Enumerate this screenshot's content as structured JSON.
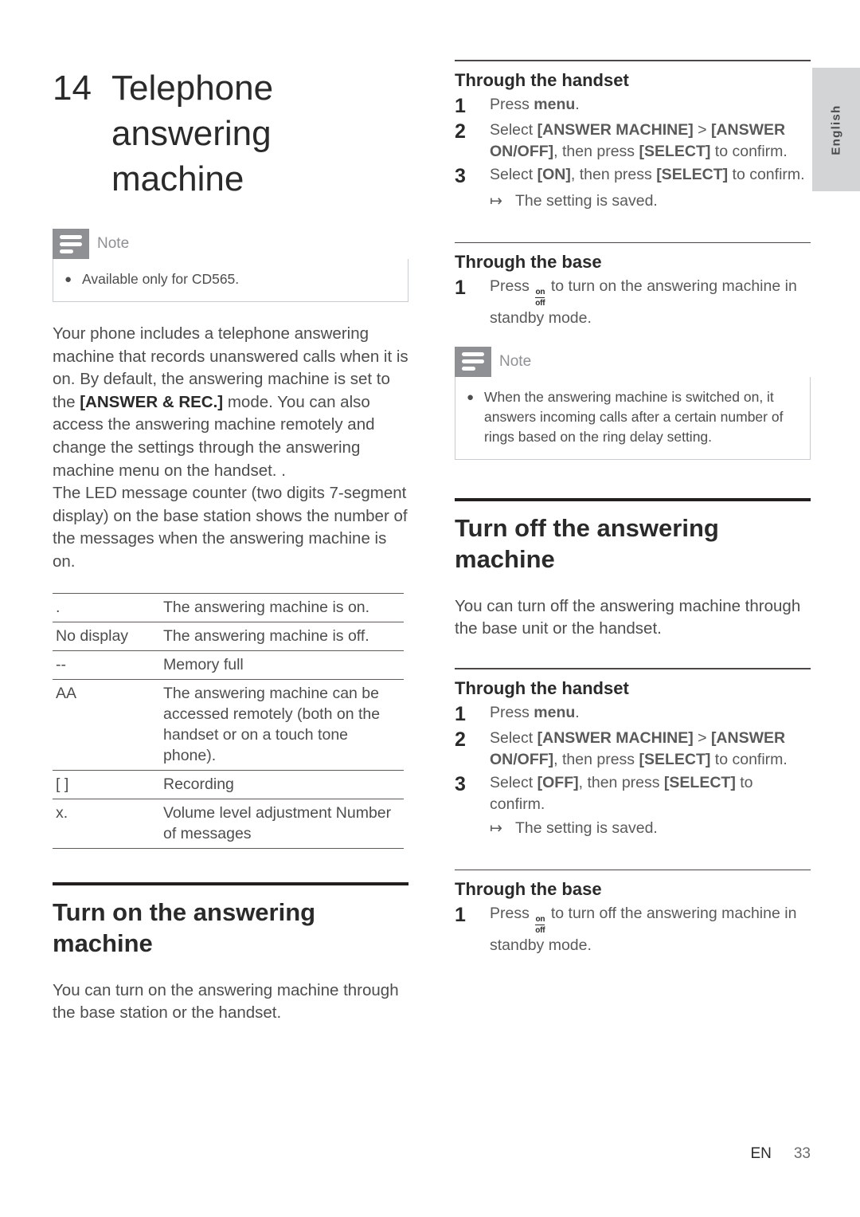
{
  "sidebar": {
    "language_tab": "English"
  },
  "chapter": {
    "number": "14",
    "title": "Telephone answering machine"
  },
  "left_column": {
    "note": {
      "label": "Note",
      "icon": "note-lines-icon",
      "items": [
        "Available only for CD565."
      ]
    },
    "intro_paragraph": {
      "before": "Your phone includes a telephone answering machine that records unanswered calls when it is on. By default, the answering machine is set to the ",
      "emphasis": "[ANSWER & REC.]",
      "after": " mode. You can also access the answering machine remotely and change the settings through the answering machine menu on the handset. ."
    },
    "led_paragraph": "The LED message counter (two digits 7-segment display) on the base station shows the number of the messages when the answering machine is on.",
    "led_table": {
      "rows": [
        {
          "key": ".",
          "value": "The answering machine is on."
        },
        {
          "key": "No display",
          "value": "The answering machine is off."
        },
        {
          "key": "--",
          "value": "Memory full"
        },
        {
          "key": "AA",
          "value": "The answering machine can be accessed remotely (both on the handset or on a touch tone phone)."
        },
        {
          "key": "[ ]",
          "value": "Recording"
        },
        {
          "key": "x.",
          "value": "Volume level adjustment Number of messages"
        }
      ]
    },
    "turn_on_section": {
      "heading": "Turn on the answering machine",
      "paragraph": "You can turn on the answering machine through the base station or the handset."
    }
  },
  "right_column": {
    "turn_on_handset": {
      "heading": "Through the handset",
      "steps": [
        {
          "number": "1",
          "parts": [
            {
              "text": "Press ",
              "bold": false
            },
            {
              "text": "menu",
              "bold": true
            },
            {
              "text": ".",
              "bold": false
            }
          ]
        },
        {
          "number": "2",
          "parts": [
            {
              "text": "Select ",
              "bold": false
            },
            {
              "text": "[ANSWER MACHINE]",
              "bold": true
            },
            {
              "text": " > ",
              "bold": false
            },
            {
              "text": "[ANSWER ON/OFF]",
              "bold": true
            },
            {
              "text": ", then press ",
              "bold": false
            },
            {
              "text": "[SELECT]",
              "bold": true
            },
            {
              "text": " to confirm.",
              "bold": false
            }
          ]
        },
        {
          "number": "3",
          "parts": [
            {
              "text": "Select ",
              "bold": false
            },
            {
              "text": "[ON]",
              "bold": true
            },
            {
              "text": ", then press ",
              "bold": false
            },
            {
              "text": "[SELECT]",
              "bold": true
            },
            {
              "text": " to confirm.",
              "bold": false
            }
          ],
          "result": "The setting is saved."
        }
      ]
    },
    "turn_on_base": {
      "heading": "Through the base",
      "step_number": "1",
      "step_before": "Press ",
      "step_icon": {
        "name": "on-off-key-icon",
        "top": "on",
        "bottom": "off"
      },
      "step_after": " to turn on the answering machine in standby mode."
    },
    "note": {
      "label": "Note",
      "icon": "note-lines-icon",
      "items": [
        "When the answering machine is switched on, it answers incoming calls after a certain number of rings based on the ring delay setting."
      ]
    },
    "turn_off_section": {
      "heading": "Turn off the answering machine",
      "paragraph": "You can turn off the answering machine through the base unit or the handset."
    },
    "turn_off_handset": {
      "heading": "Through the handset",
      "steps": [
        {
          "number": "1",
          "parts": [
            {
              "text": "Press ",
              "bold": false
            },
            {
              "text": "menu",
              "bold": true
            },
            {
              "text": ".",
              "bold": false
            }
          ]
        },
        {
          "number": "2",
          "parts": [
            {
              "text": "Select ",
              "bold": false
            },
            {
              "text": "[ANSWER MACHINE]",
              "bold": true
            },
            {
              "text": " > ",
              "bold": false
            },
            {
              "text": "[ANSWER ON/OFF]",
              "bold": true
            },
            {
              "text": ", then press ",
              "bold": false
            },
            {
              "text": "[SELECT]",
              "bold": true
            },
            {
              "text": " to confirm.",
              "bold": false
            }
          ]
        },
        {
          "number": "3",
          "parts": [
            {
              "text": "Select ",
              "bold": false
            },
            {
              "text": "[OFF]",
              "bold": true
            },
            {
              "text": ", then press ",
              "bold": false
            },
            {
              "text": "[SELECT]",
              "bold": true
            },
            {
              "text": " to confirm.",
              "bold": false
            }
          ],
          "result": "The setting is saved."
        }
      ]
    },
    "turn_off_base": {
      "heading": "Through the base",
      "step_number": "1",
      "step_before": "Press ",
      "step_icon": {
        "name": "on-off-key-icon",
        "top": "on",
        "bottom": "off"
      },
      "step_after": " to turn off the answering machine in standby mode."
    }
  },
  "footer": {
    "language_code": "EN",
    "page_number": "33"
  },
  "colors": {
    "note_icon_bg": "#8e9094",
    "note_border": "#c9cdd2",
    "tab_bg": "#d2d4d6",
    "heading": "#2a2a2a",
    "body_text": "#4d4d4d"
  }
}
